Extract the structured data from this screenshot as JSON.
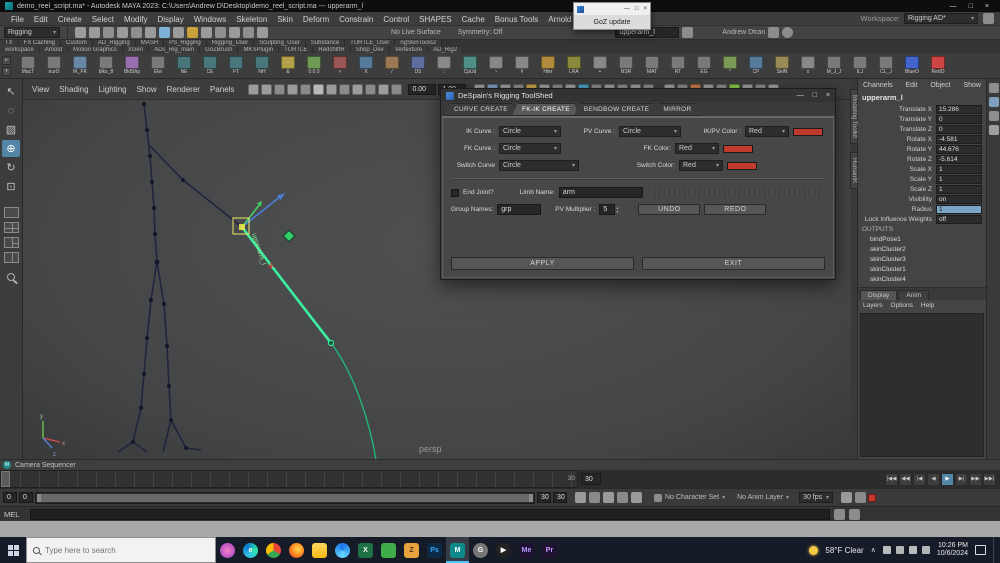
{
  "titlebar": {
    "title": "demo_reel_script.ma* - Autodesk MAYA 2023: C:\\Users\\Andrew D\\Desktop\\demo_reel_script.ma  ---  upperarm_l",
    "controls": {
      "minimize": "—",
      "maximize": "□",
      "close": "×"
    }
  },
  "menubar": {
    "items": [
      "File",
      "Edit",
      "Create",
      "Select",
      "Modify",
      "Display",
      "Windows",
      "Skeleton",
      "Skin",
      "Deform",
      "Constrain",
      "Control",
      "SHAPES",
      "Cache",
      "Bonus Tools",
      "Arnold",
      "Help"
    ],
    "workspace_label": "Workspace:",
    "workspace_value": "Rigging AD*"
  },
  "statusline": {
    "mode": "Rigging",
    "icons": [
      "#9b9b9b",
      "#9b9b9b",
      "#8f8f8f",
      "#9b9b9b",
      "#8f8f8f",
      "#9b9b9b",
      "#7fb2d9",
      "#9b9b9b",
      "#c9a13b",
      "#9b9b9b",
      "#8f8f8f",
      "#9b9b9b",
      "#8f8f8f",
      "#9b9b9b"
    ],
    "live_surface": "No Live Surface",
    "symmetry": "Symmetry: Off",
    "selection_field": "upperarm_l",
    "user": "Andrew Dtran"
  },
  "shelf": {
    "tabs_row1": [
      "TX",
      "FX Caching",
      "Custom",
      "AD_Rigging",
      "MASH",
      "PS_Rigging",
      "Rigging_User",
      "Sculpting_User",
      "Substance",
      "TURTLE_User",
      "ngSkinTools2"
    ],
    "tabs_row2": [
      "workspace",
      "Arnold",
      "Motion Graphics",
      "XGen",
      "ADs_Rig_main",
      "GoZBrush",
      "MKSPlugin",
      "TURTLE",
      "RedshiftR",
      "Shop_Dev",
      "Vertexture",
      "AD_Rig2"
    ],
    "icons": [
      {
        "label": "MacT",
        "color": "#7a7a7a"
      },
      {
        "label": "nurO",
        "color": "#7a7a7a"
      },
      {
        "label": "IK_FK",
        "color": "#6b87a8"
      },
      {
        "label": "blks_8",
        "color": "#7a7a7a"
      },
      {
        "label": "BldShp",
        "color": "#9a6fb0"
      },
      {
        "label": "Elw",
        "color": "#7a7a7a"
      },
      {
        "label": "NE",
        "color": "#49767a"
      },
      {
        "label": "CE",
        "color": "#49767a"
      },
      {
        "label": "FT",
        "color": "#49767a"
      },
      {
        "label": "NH",
        "color": "#49767a"
      },
      {
        "label": "&",
        "color": "#b3a04a"
      },
      {
        "label": "0.0.0",
        "color": "#6f9a55"
      },
      {
        "label": "<",
        "color": "#9a5555"
      },
      {
        "label": "X",
        "color": "#557a9a"
      },
      {
        "label": "/",
        "color": "#9a7a55"
      },
      {
        "label": "DS",
        "color": "#5c6e9e"
      },
      {
        "label": "::",
        "color": "#888888"
      },
      {
        "label": "CpUd",
        "color": "#4f8f86"
      },
      {
        "label": "~",
        "color": "#888888"
      },
      {
        "label": "#",
        "color": "#888888"
      },
      {
        "label": "Hier",
        "color": "#b08a3f"
      },
      {
        "label": "LRA",
        "color": "#8a8a3f"
      },
      {
        "label": "+",
        "color": "#888888"
      },
      {
        "label": "NSR",
        "color": "#7a7a7a"
      },
      {
        "label": "MAT",
        "color": "#7a7a7a"
      },
      {
        "label": "RT",
        "color": "#7a7a7a"
      },
      {
        "label": "EG",
        "color": "#7a7a7a"
      },
      {
        "label": "*",
        "color": "#7a9a55"
      },
      {
        "label": "CP",
        "color": "#557a9a"
      },
      {
        "label": "SelN",
        "color": "#9a8a55"
      },
      {
        "label": "o",
        "color": "#888888"
      },
      {
        "label": "M_J_J",
        "color": "#7a7a7a"
      },
      {
        "label": "ILJ",
        "color": "#7a7a7a"
      },
      {
        "label": "CL_J",
        "color": "#7a7a7a"
      },
      {
        "label": "BlueO",
        "color": "#4466cc"
      },
      {
        "label": "RedO",
        "color": "#cc4444"
      }
    ]
  },
  "toolbox": {
    "tools": [
      {
        "name": "select-tool",
        "glyph": "↖"
      },
      {
        "name": "lasso-tool",
        "glyph": "◌"
      },
      {
        "name": "paint-select-tool",
        "glyph": "▧"
      },
      {
        "name": "move-tool",
        "glyph": "⊕",
        "active": true
      },
      {
        "name": "rotate-tool",
        "glyph": "↻"
      },
      {
        "name": "scale-tool",
        "glyph": "⊡"
      }
    ]
  },
  "viewport": {
    "menus": [
      "View",
      "Shading",
      "Lighting",
      "Show",
      "Renderer",
      "Panels"
    ],
    "icons_a": [
      "#9c9c9c",
      "#9c9c9c",
      "#8a8a8a",
      "#9c9c9c",
      "#8a8a8a",
      "#b8b8b8",
      "#9c9c9c",
      "#8a8a8a",
      "#9c9c9c",
      "#8a8a8a",
      "#9c9c9c",
      "#8a8a8a"
    ],
    "field1": "0.00",
    "field2": "1.00",
    "icons_b": [
      "#9c9c9c",
      "#7f9fc0",
      "#9c9c9c",
      "#8a8a8a",
      "#c7a44a",
      "#9c9c9c",
      "#8a8a8a",
      "#9c9c9c",
      "#4aa0c7",
      "#8a8a8a",
      "#9c9c9c",
      "#8a8a8a",
      "#9c9c9c",
      "#8a8a8a"
    ],
    "icons_c": [
      "#9c9c9c",
      "#8a8a8a",
      "#c77a4a",
      "#9c9c9c",
      "#8a8a8a",
      "#8ac74a",
      "#9c9c9c",
      "#8a8a8a",
      "#9c9c9c"
    ],
    "camera_label": "persp",
    "joint_label": "upperarm_l"
  },
  "side_tabs": {
    "left": [
      "Modeling Toolkit",
      "HumanIK"
    ]
  },
  "sidebar_right": {
    "icons": [
      "#8f8f8f",
      "#7f9fc0",
      "#8f8f8f",
      "#a0a0a0"
    ]
  },
  "channelbox": {
    "menus": [
      "Channels",
      "Edit",
      "Object",
      "Show"
    ],
    "node": "upperarm_l",
    "attrs": [
      {
        "label": "Translate X",
        "value": "15.286"
      },
      {
        "label": "Translate Y",
        "value": "0"
      },
      {
        "label": "Translate Z",
        "value": "0"
      },
      {
        "label": "Rotate X",
        "value": "-4.581"
      },
      {
        "label": "Rotate Y",
        "value": "44.676"
      },
      {
        "label": "Rotate Z",
        "value": "-5.614"
      },
      {
        "label": "Scale X",
        "value": "1"
      },
      {
        "label": "Scale Y",
        "value": "1"
      },
      {
        "label": "Scale Z",
        "value": "1"
      },
      {
        "label": "Visibility",
        "value": "on"
      },
      {
        "label": "Radius",
        "value": "1",
        "active": true
      },
      {
        "label": "Lock Influence Weights",
        "value": "off"
      }
    ],
    "outputs_label": "OUTPUTS",
    "outputs": [
      "bindPose1",
      "skinCluster2",
      "skinCluster3",
      "skinCluster1",
      "skinCluster4"
    ]
  },
  "layers": {
    "tabs": [
      {
        "label": "Display",
        "active": true
      },
      {
        "label": "Anim"
      }
    ],
    "menus": [
      "Layers",
      "Options",
      "Help"
    ]
  },
  "dialog": {
    "title": "DeSpain's Rigging ToolShed",
    "controls": {
      "minimize": "—",
      "maximize": "□",
      "close": "×"
    },
    "tabs": [
      {
        "label": "CURVE CREATE"
      },
      {
        "label": "FK-IK CREATE",
        "active": true
      },
      {
        "label": "BENDBOW CREATE"
      },
      {
        "label": "MIRROR"
      }
    ],
    "ik_curve_label": "IK Curve :",
    "ik_curve_value": "Circle",
    "pv_curve_label": "PV Curve :",
    "pv_curve_value": "Circle",
    "ikpv_color_label": "IK/PV Color :",
    "ikpv_color_value": "Red",
    "fk_curve_label": "FK Curve :",
    "fk_curve_value": "Circle",
    "fk_color_label": "FK Color:",
    "fk_color_value": "Red",
    "switch_curve_label": "Switch Curve",
    "switch_curve_value": "Circle",
    "switch_color_label": "Switch Color:",
    "switch_color_value": "Red",
    "end_joint_label": "End Joint?",
    "limb_name_label": "Limb Name:",
    "limb_name_value": "arm",
    "group_names_label": "Group Names:",
    "group_names_value": "grp",
    "pv_multiplier_label": "PV Multiplier :",
    "pv_multiplier_value": "5",
    "undo": "UNDO",
    "redo": "REDO",
    "apply": "APPLY",
    "exit": "EXIT",
    "swatch_color": "#c13a2e"
  },
  "goz": {
    "minimize": "—",
    "maximize": "□",
    "close": "×",
    "body": "GoZ update"
  },
  "sequencer": {
    "label": "Camera Sequencer",
    "avatar": "M"
  },
  "timeline": {
    "current": "30",
    "end_label": "30",
    "transport": [
      {
        "glyph": "|◀◀"
      },
      {
        "glyph": "◀◀"
      },
      {
        "glyph": "|◀"
      },
      {
        "glyph": "◀"
      },
      {
        "glyph": "▶",
        "active": true
      },
      {
        "glyph": "▶|"
      },
      {
        "glyph": "▶▶"
      },
      {
        "glyph": "▶▶|"
      }
    ]
  },
  "range": {
    "start1": "0",
    "start2": "0",
    "end1": "30",
    "end2": "30",
    "icons": [
      "#9a9a9a",
      "#8a8a8a",
      "#9a9a9a",
      "#8a8a8a",
      "#9a9a9a"
    ],
    "character_set": "No Character Set",
    "anim_layer": "No Anim Layer",
    "fps": "30 fps",
    "icons2": [
      "#9a9a9a",
      "#8a8a8a"
    ]
  },
  "mel": {
    "label": "MEL"
  },
  "taskbar": {
    "search_placeholder": "Type here to search",
    "apps": [
      {
        "name": "people-app-icon",
        "bg": "radial-gradient(circle,#f780c9,#9a3fc0)",
        "letter": "",
        "radius": "50%"
      },
      {
        "name": "edge-icon",
        "bg": "conic-gradient(from 200deg,#35c1e8,#0b7bd1,#2ee6a8,#35c1e8)",
        "letter": "e",
        "radius": "50%"
      },
      {
        "name": "chrome-icon",
        "bg": "conic-gradient(#ea4335 0 33%,#34a853 0 66%,#fbbc05 0 100%)",
        "letter": "",
        "radius": "50%"
      },
      {
        "name": "firefox-icon",
        "bg": "radial-gradient(circle at 60% 40%,#ffd54a,#ff7a18 60%,#b5007f)",
        "letter": "",
        "radius": "50%"
      },
      {
        "name": "file-explorer-icon",
        "bg": "linear-gradient(#ffd75e,#f5b916)",
        "letter": ""
      },
      {
        "name": "browser2-icon",
        "bg": "conic-gradient(#1a73e8,#66d9ff,#1a73e8)",
        "letter": "",
        "radius": "50%"
      },
      {
        "name": "excel-icon",
        "bg": "#1e7145",
        "letter": "X"
      },
      {
        "name": "green-app-icon",
        "bg": "#3fae49",
        "letter": ""
      },
      {
        "name": "zbrush-icon",
        "bg": "#e8a33d",
        "letter": "Z",
        "fg": "#4a3208"
      },
      {
        "name": "photoshop-icon",
        "bg": "#0c2a45",
        "letter": "Ps",
        "fg": "#31a8ff"
      },
      {
        "name": "maya-icon",
        "bg": "#0f8a8a",
        "letter": "M",
        "active": true
      },
      {
        "name": "goz-app-icon",
        "bg": "#777777",
        "letter": "G",
        "radius": "50%"
      },
      {
        "name": "media-player-icon",
        "bg": "#222222",
        "letter": "▶",
        "radius": "50%"
      },
      {
        "name": "media-encoder-icon",
        "bg": "#1d1331",
        "letter": "Me",
        "fg": "#b59aff"
      },
      {
        "name": "premiere-icon",
        "bg": "#1d1331",
        "letter": "Pr",
        "fg": "#cf96ff"
      }
    ],
    "tray": {
      "weather": "58°F Clear",
      "chevron": "∧",
      "icons": [
        "#d8d8d8",
        "#cfcfcf",
        "#d8d8d8",
        "#cfcfcf"
      ],
      "time": "10:26 PM",
      "date": "10/6/2024"
    }
  }
}
